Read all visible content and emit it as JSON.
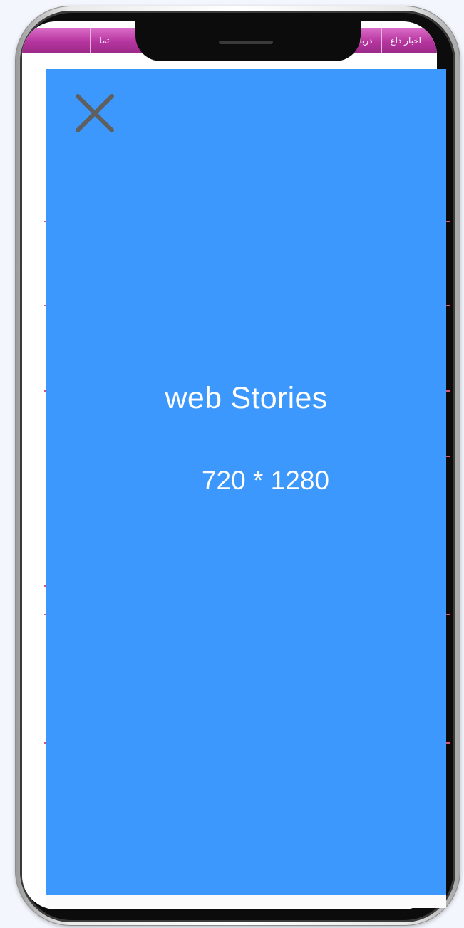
{
  "background_site": {
    "nav_items": [
      "اخبار داغ",
      "درباره ما",
      "تما"
    ]
  },
  "story": {
    "title": "web Stories",
    "subtitle": "720 * 1280",
    "close_icon": "close-icon",
    "background_color": "#3d98fd"
  },
  "device": {
    "frame": "smartphone-notch"
  }
}
